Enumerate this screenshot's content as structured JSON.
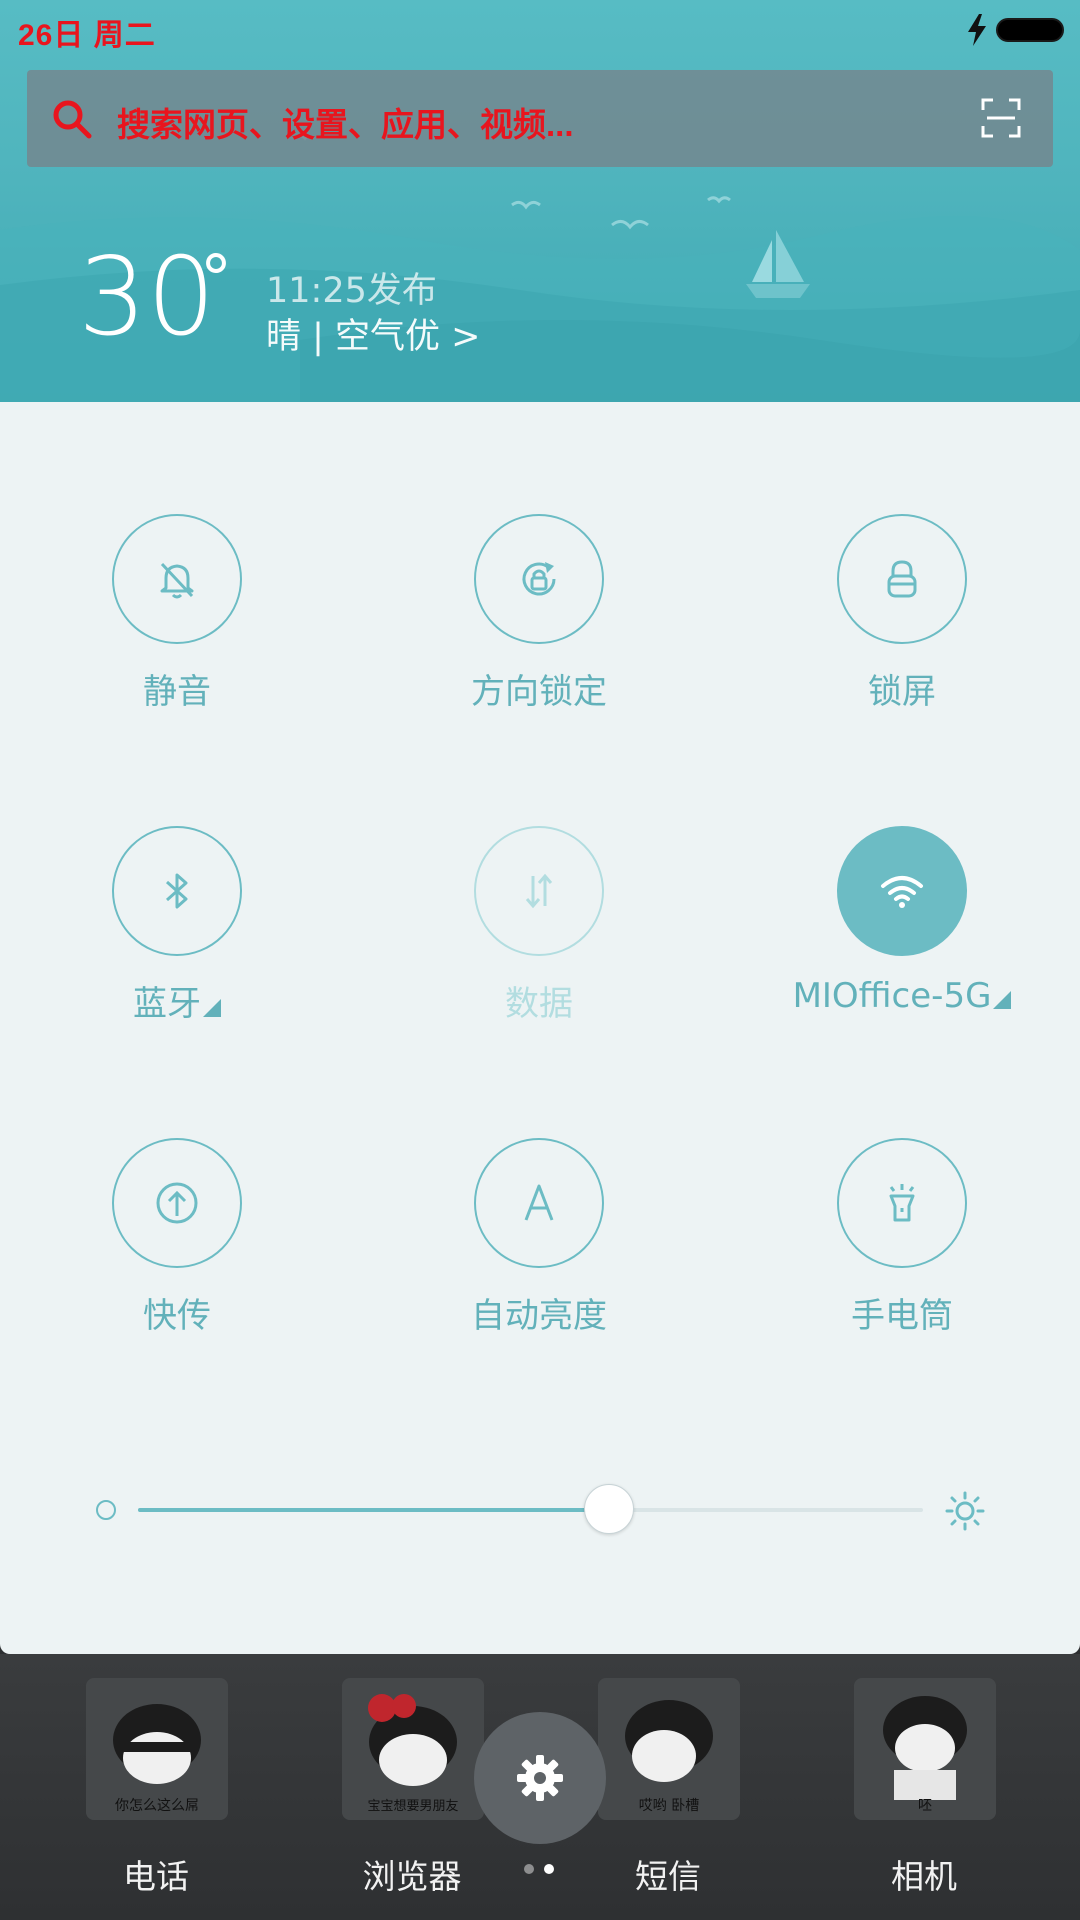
{
  "status_bar": {
    "date": "26日 周二",
    "charging_icon": "bolt-icon",
    "battery_icon": "battery-icon"
  },
  "search": {
    "placeholder": "搜索网页、设置、应用、视频...",
    "left_icon": "search-icon",
    "right_icon": "scan-icon"
  },
  "weather": {
    "temperature": "30",
    "unit": "°",
    "publish_time": "11:25发布",
    "description": "晴 | 空气优 >"
  },
  "toggles": [
    {
      "label": "静音",
      "icon": "bell-off-icon",
      "state": "off"
    },
    {
      "label": "方向锁定",
      "icon": "rotation-lock-icon",
      "state": "off"
    },
    {
      "label": "锁屏",
      "icon": "lock-icon",
      "state": "off"
    },
    {
      "label": "蓝牙",
      "icon": "bluetooth-icon",
      "state": "off",
      "has_menu": true
    },
    {
      "label": "数据",
      "icon": "mobile-data-icon",
      "state": "disabled"
    },
    {
      "label": "MIOffice-5G",
      "icon": "wifi-icon",
      "state": "on",
      "has_menu": true
    },
    {
      "label": "快传",
      "icon": "share-upload-icon",
      "state": "off"
    },
    {
      "label": "自动亮度",
      "icon": "auto-brightness-icon",
      "state": "off"
    },
    {
      "label": "手电筒",
      "icon": "flashlight-icon",
      "state": "off"
    }
  ],
  "brightness": {
    "value": 0.6,
    "min_icon": "brightness-low-icon",
    "max_icon": "brightness-high-icon"
  },
  "dock": {
    "apps": [
      {
        "label": "电话",
        "icon_caption": "你怎么这么屌"
      },
      {
        "label": "浏览器",
        "icon_caption": "宝宝想要男朋友"
      },
      {
        "label": "短信",
        "icon_caption": "哎哟 卧槽"
      },
      {
        "label": "相机",
        "icon_caption": "呸"
      }
    ],
    "settings_icon": "gear-icon",
    "pages": 2,
    "current_page": 2
  },
  "colors": {
    "accent": "#6cbcc4",
    "label": "#62b1ba",
    "disabled": "#b2dde0",
    "status_text": "#e8151e"
  }
}
